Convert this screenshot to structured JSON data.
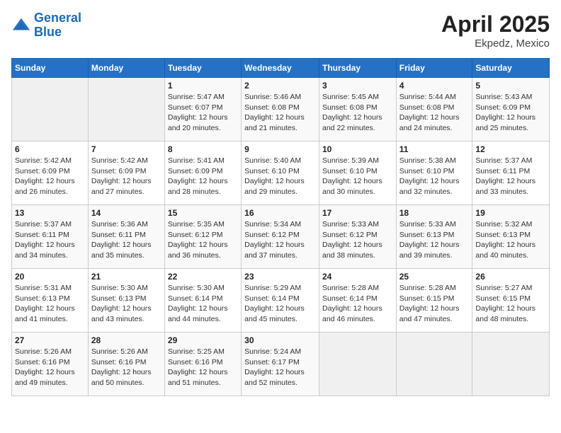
{
  "header": {
    "logo_line1": "General",
    "logo_line2": "Blue",
    "month_year": "April 2025",
    "location": "Ekpedz, Mexico"
  },
  "weekdays": [
    "Sunday",
    "Monday",
    "Tuesday",
    "Wednesday",
    "Thursday",
    "Friday",
    "Saturday"
  ],
  "weeks": [
    [
      {
        "day": "",
        "sunrise": "",
        "sunset": "",
        "daylight": "",
        "empty": true
      },
      {
        "day": "",
        "sunrise": "",
        "sunset": "",
        "daylight": "",
        "empty": true
      },
      {
        "day": "1",
        "sunrise": "Sunrise: 5:47 AM",
        "sunset": "Sunset: 6:07 PM",
        "daylight": "Daylight: 12 hours and 20 minutes."
      },
      {
        "day": "2",
        "sunrise": "Sunrise: 5:46 AM",
        "sunset": "Sunset: 6:08 PM",
        "daylight": "Daylight: 12 hours and 21 minutes."
      },
      {
        "day": "3",
        "sunrise": "Sunrise: 5:45 AM",
        "sunset": "Sunset: 6:08 PM",
        "daylight": "Daylight: 12 hours and 22 minutes."
      },
      {
        "day": "4",
        "sunrise": "Sunrise: 5:44 AM",
        "sunset": "Sunset: 6:08 PM",
        "daylight": "Daylight: 12 hours and 24 minutes."
      },
      {
        "day": "5",
        "sunrise": "Sunrise: 5:43 AM",
        "sunset": "Sunset: 6:09 PM",
        "daylight": "Daylight: 12 hours and 25 minutes."
      }
    ],
    [
      {
        "day": "6",
        "sunrise": "Sunrise: 5:42 AM",
        "sunset": "Sunset: 6:09 PM",
        "daylight": "Daylight: 12 hours and 26 minutes."
      },
      {
        "day": "7",
        "sunrise": "Sunrise: 5:42 AM",
        "sunset": "Sunset: 6:09 PM",
        "daylight": "Daylight: 12 hours and 27 minutes."
      },
      {
        "day": "8",
        "sunrise": "Sunrise: 5:41 AM",
        "sunset": "Sunset: 6:09 PM",
        "daylight": "Daylight: 12 hours and 28 minutes."
      },
      {
        "day": "9",
        "sunrise": "Sunrise: 5:40 AM",
        "sunset": "Sunset: 6:10 PM",
        "daylight": "Daylight: 12 hours and 29 minutes."
      },
      {
        "day": "10",
        "sunrise": "Sunrise: 5:39 AM",
        "sunset": "Sunset: 6:10 PM",
        "daylight": "Daylight: 12 hours and 30 minutes."
      },
      {
        "day": "11",
        "sunrise": "Sunrise: 5:38 AM",
        "sunset": "Sunset: 6:10 PM",
        "daylight": "Daylight: 12 hours and 32 minutes."
      },
      {
        "day": "12",
        "sunrise": "Sunrise: 5:37 AM",
        "sunset": "Sunset: 6:11 PM",
        "daylight": "Daylight: 12 hours and 33 minutes."
      }
    ],
    [
      {
        "day": "13",
        "sunrise": "Sunrise: 5:37 AM",
        "sunset": "Sunset: 6:11 PM",
        "daylight": "Daylight: 12 hours and 34 minutes."
      },
      {
        "day": "14",
        "sunrise": "Sunrise: 5:36 AM",
        "sunset": "Sunset: 6:11 PM",
        "daylight": "Daylight: 12 hours and 35 minutes."
      },
      {
        "day": "15",
        "sunrise": "Sunrise: 5:35 AM",
        "sunset": "Sunset: 6:12 PM",
        "daylight": "Daylight: 12 hours and 36 minutes."
      },
      {
        "day": "16",
        "sunrise": "Sunrise: 5:34 AM",
        "sunset": "Sunset: 6:12 PM",
        "daylight": "Daylight: 12 hours and 37 minutes."
      },
      {
        "day": "17",
        "sunrise": "Sunrise: 5:33 AM",
        "sunset": "Sunset: 6:12 PM",
        "daylight": "Daylight: 12 hours and 38 minutes."
      },
      {
        "day": "18",
        "sunrise": "Sunrise: 5:33 AM",
        "sunset": "Sunset: 6:13 PM",
        "daylight": "Daylight: 12 hours and 39 minutes."
      },
      {
        "day": "19",
        "sunrise": "Sunrise: 5:32 AM",
        "sunset": "Sunset: 6:13 PM",
        "daylight": "Daylight: 12 hours and 40 minutes."
      }
    ],
    [
      {
        "day": "20",
        "sunrise": "Sunrise: 5:31 AM",
        "sunset": "Sunset: 6:13 PM",
        "daylight": "Daylight: 12 hours and 41 minutes."
      },
      {
        "day": "21",
        "sunrise": "Sunrise: 5:30 AM",
        "sunset": "Sunset: 6:13 PM",
        "daylight": "Daylight: 12 hours and 43 minutes."
      },
      {
        "day": "22",
        "sunrise": "Sunrise: 5:30 AM",
        "sunset": "Sunset: 6:14 PM",
        "daylight": "Daylight: 12 hours and 44 minutes."
      },
      {
        "day": "23",
        "sunrise": "Sunrise: 5:29 AM",
        "sunset": "Sunset: 6:14 PM",
        "daylight": "Daylight: 12 hours and 45 minutes."
      },
      {
        "day": "24",
        "sunrise": "Sunrise: 5:28 AM",
        "sunset": "Sunset: 6:14 PM",
        "daylight": "Daylight: 12 hours and 46 minutes."
      },
      {
        "day": "25",
        "sunrise": "Sunrise: 5:28 AM",
        "sunset": "Sunset: 6:15 PM",
        "daylight": "Daylight: 12 hours and 47 minutes."
      },
      {
        "day": "26",
        "sunrise": "Sunrise: 5:27 AM",
        "sunset": "Sunset: 6:15 PM",
        "daylight": "Daylight: 12 hours and 48 minutes."
      }
    ],
    [
      {
        "day": "27",
        "sunrise": "Sunrise: 5:26 AM",
        "sunset": "Sunset: 6:16 PM",
        "daylight": "Daylight: 12 hours and 49 minutes."
      },
      {
        "day": "28",
        "sunrise": "Sunrise: 5:26 AM",
        "sunset": "Sunset: 6:16 PM",
        "daylight": "Daylight: 12 hours and 50 minutes."
      },
      {
        "day": "29",
        "sunrise": "Sunrise: 5:25 AM",
        "sunset": "Sunset: 6:16 PM",
        "daylight": "Daylight: 12 hours and 51 minutes."
      },
      {
        "day": "30",
        "sunrise": "Sunrise: 5:24 AM",
        "sunset": "Sunset: 6:17 PM",
        "daylight": "Daylight: 12 hours and 52 minutes."
      },
      {
        "day": "",
        "sunrise": "",
        "sunset": "",
        "daylight": "",
        "empty": true
      },
      {
        "day": "",
        "sunrise": "",
        "sunset": "",
        "daylight": "",
        "empty": true
      },
      {
        "day": "",
        "sunrise": "",
        "sunset": "",
        "daylight": "",
        "empty": true
      }
    ]
  ]
}
